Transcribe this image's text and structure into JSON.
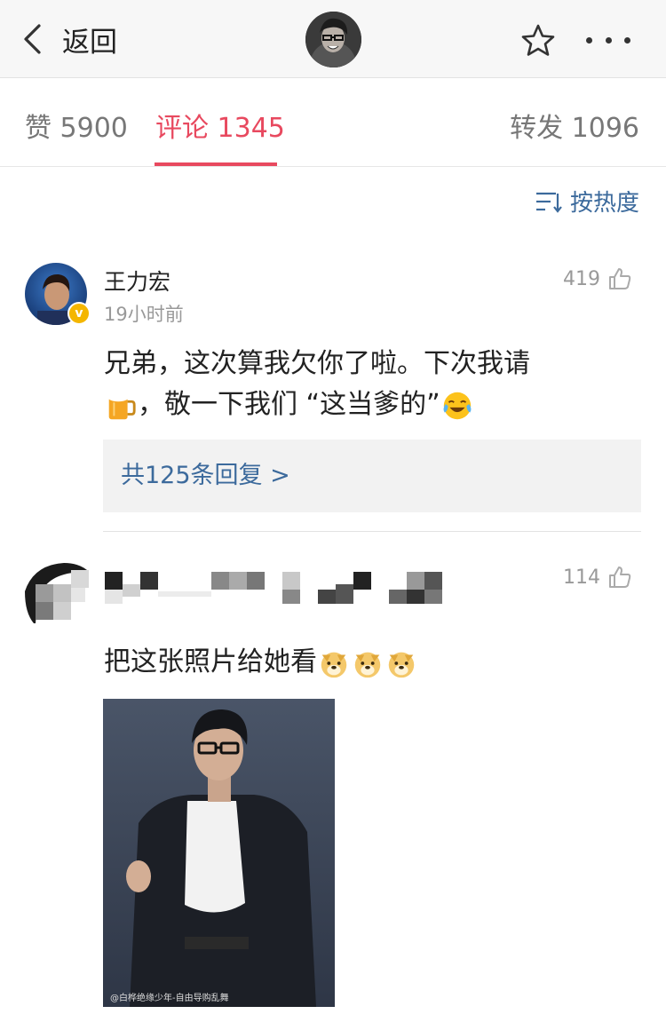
{
  "header": {
    "back_label": "返回",
    "back_icon": "chevron-left-icon",
    "favorite_icon": "star-icon",
    "more_icon": "more-dots-icon"
  },
  "tabs": {
    "likes": "赞 5900",
    "comments": "评论 1345",
    "reposts": "转发 1096",
    "active_color": "#e8495f"
  },
  "sort": {
    "label": "按热度",
    "icon": "sort-icon"
  },
  "comments": [
    {
      "name": "王力宏",
      "time": "19小时前",
      "likes": "419",
      "text_line1": "兄弟，这次算我欠你了啦。下次我请",
      "text_line2": "，敬一下我们 “这当爹的”",
      "replies": "共125条回复 >",
      "verified": "v"
    },
    {
      "likes": "114",
      "text": "把这张照片给她看",
      "photo_watermark": "@白桦绝缘少年-自由导购乱舞"
    }
  ],
  "colors": {
    "link": "#3c6a9c",
    "accent": "#e8495f",
    "verified_badge": "#f4b600"
  }
}
